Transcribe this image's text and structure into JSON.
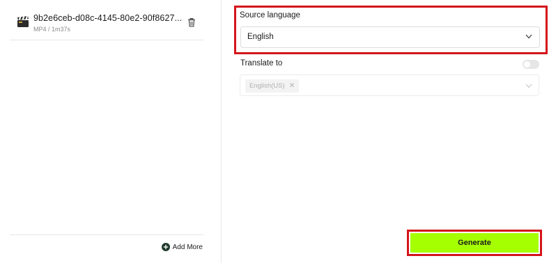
{
  "file": {
    "name": "9b2e6ceb-d08c-4145-80e2-90f8627...",
    "meta": "MP4 / 1m37s",
    "icon": "clapperboard-icon"
  },
  "left_footer": {
    "add_more_label": "Add More",
    "icon": "plus-circle-icon"
  },
  "source_language": {
    "label": "Source language",
    "selected": "English"
  },
  "translate_to": {
    "label": "Translate to",
    "toggle_on": false,
    "selected_chips": [
      "English(US)"
    ]
  },
  "generate": {
    "label": "Generate"
  },
  "colors": {
    "accent_green": "#a6ff00",
    "highlight_red": "#d4141b",
    "border": "#dcdcdc"
  }
}
